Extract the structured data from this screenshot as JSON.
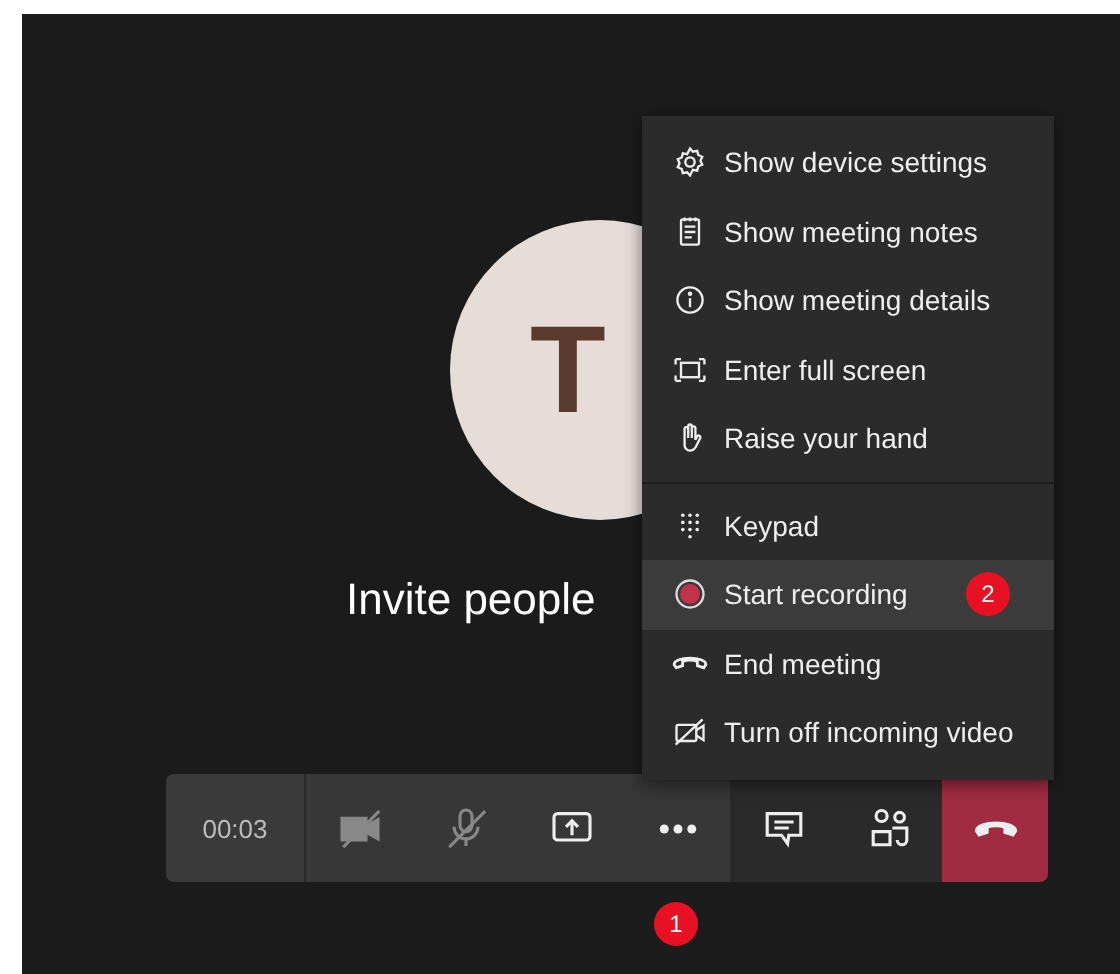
{
  "stage": {
    "avatar_initials": "T",
    "invite_text": "Invite people"
  },
  "toolbar": {
    "timer": "00:03",
    "buttons": [
      {
        "kind": "camera",
        "off": true
      },
      {
        "kind": "mic",
        "off": true
      },
      {
        "kind": "share"
      },
      {
        "kind": "more",
        "badge": "1"
      },
      {
        "kind": "chat"
      },
      {
        "kind": "people"
      },
      {
        "kind": "hangup"
      }
    ]
  },
  "menu": {
    "groups": [
      [
        {
          "label": "Show device settings",
          "selected": false
        },
        {
          "label": "Show meeting notes",
          "selected": false
        },
        {
          "label": "Show meeting details",
          "selected": false
        },
        {
          "label": "Enter full screen",
          "selected": false
        },
        {
          "label": "Raise your hand",
          "selected": false
        }
      ],
      [
        {
          "label": "Keypad",
          "selected": false
        },
        {
          "label": "Start recording",
          "selected": true,
          "badge": "2"
        },
        {
          "label": "End meeting",
          "selected": false
        },
        {
          "label": "Turn off incoming video",
          "selected": false
        }
      ]
    ]
  }
}
